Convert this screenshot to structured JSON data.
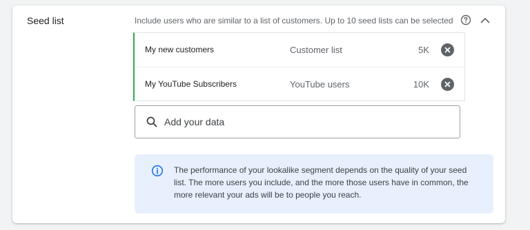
{
  "section": {
    "label": "Seed list",
    "description": "Include users who are similar to a list of customers. Up to 10 seed lists can be selected"
  },
  "icons": {
    "help": "help-circle-icon",
    "collapse": "chevron-up-icon",
    "remove": "close-circle-icon",
    "search": "search-icon",
    "info": "info-icon"
  },
  "seed_lists": [
    {
      "name": "My new customers",
      "type": "Customer list",
      "size": "5K"
    },
    {
      "name": "My YouTube Subscribers",
      "type": "YouTube users",
      "size": "10K"
    }
  ],
  "search": {
    "placeholder": "Add your data",
    "value": ""
  },
  "info": {
    "text": "The performance of your lookalike segment depends on the quality of your seed list. The more users you include, and the more those users have in common, the more relevant your ads will be to people you reach."
  },
  "colors": {
    "selected_accent": "#34a853",
    "info_background": "#e8f0fe",
    "info_icon": "#1a73e8"
  }
}
